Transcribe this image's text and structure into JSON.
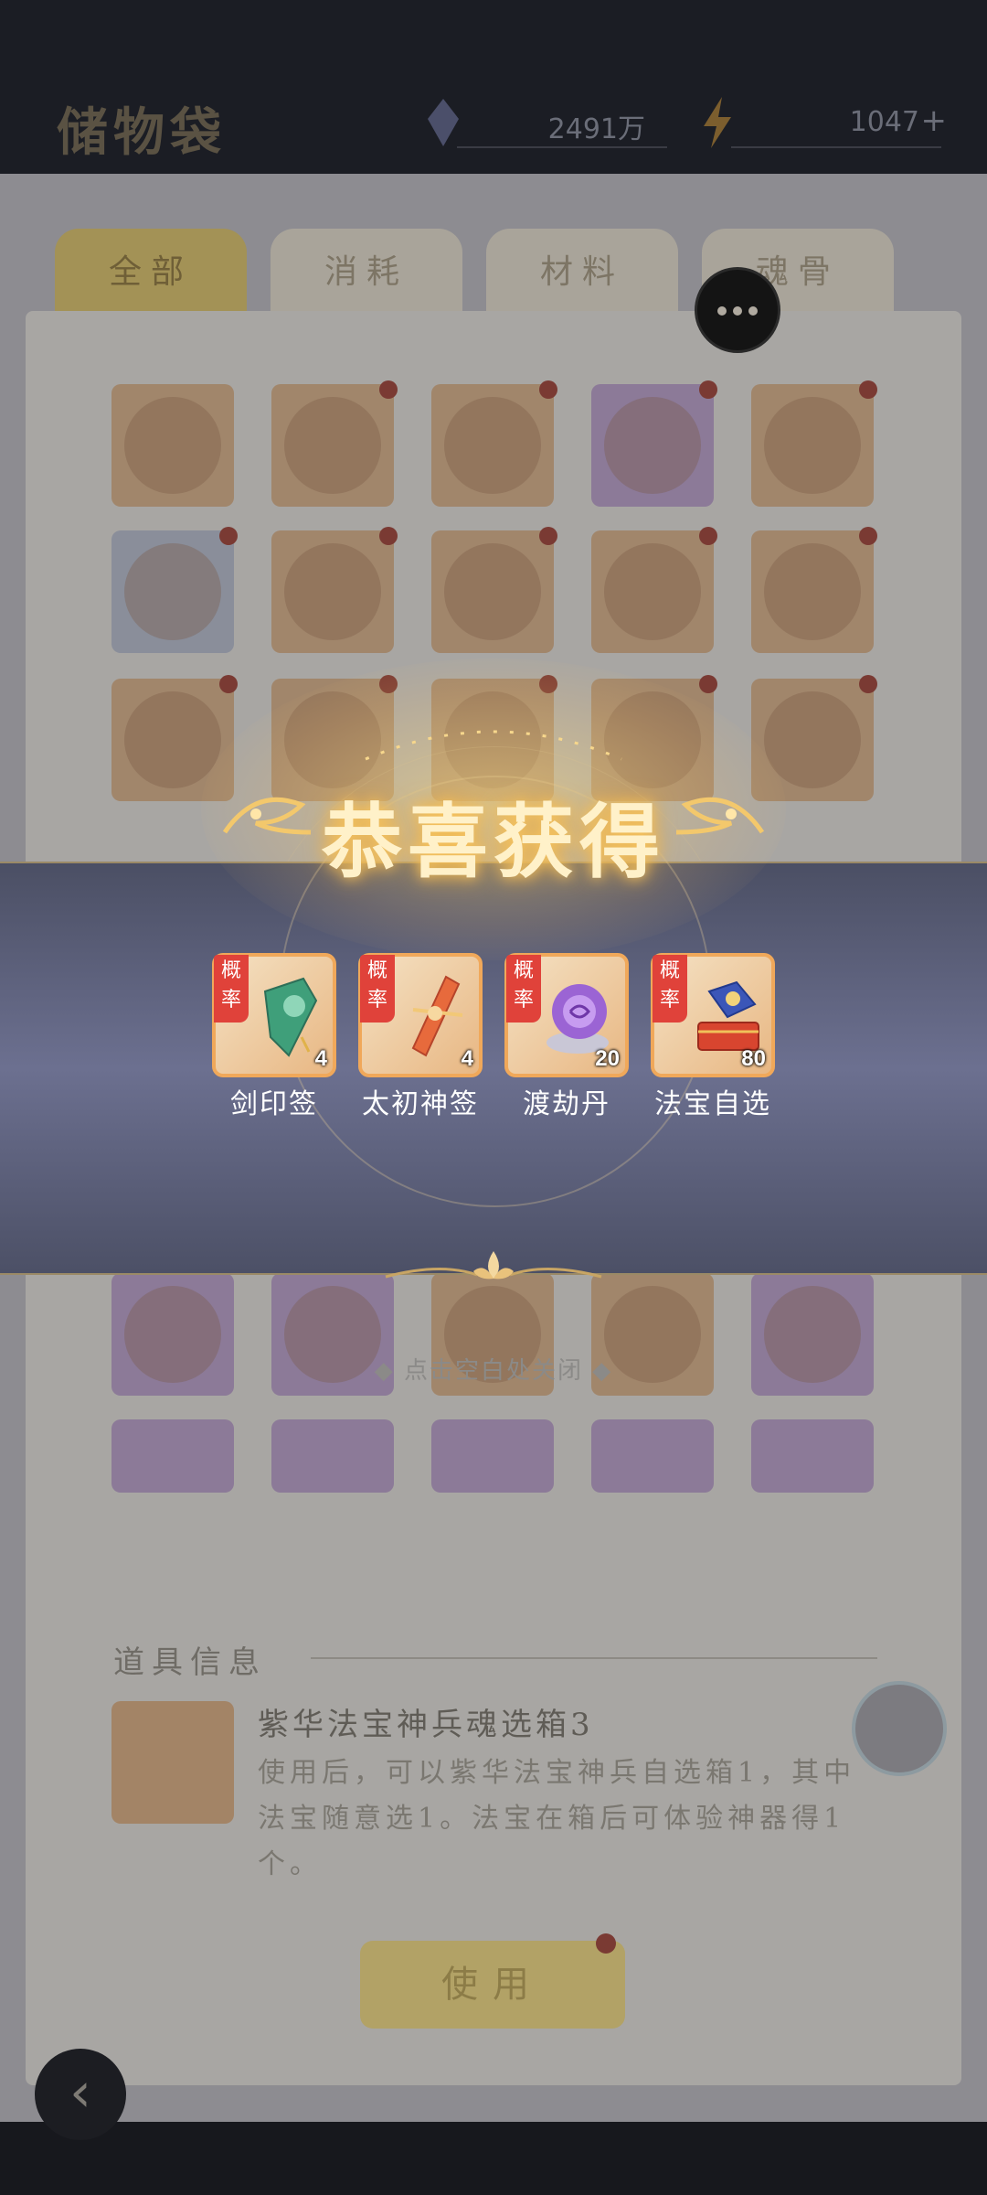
{
  "header": {
    "title": "储物袋",
    "resource_1": "2491万",
    "resource_2": "1047"
  },
  "tabs": [
    "全部",
    "消耗",
    "材料",
    "魂骨"
  ],
  "popup": {
    "title": "恭喜获得",
    "badge_text": "概率",
    "items": [
      {
        "name": "剑印签",
        "count": "4",
        "icon": "sword-seal-icon"
      },
      {
        "name": "太初神签",
        "count": "4",
        "icon": "divine-lot-icon"
      },
      {
        "name": "渡劫丹",
        "count": "20",
        "icon": "tribulation-pill-icon"
      },
      {
        "name": "法宝自选",
        "count": "80",
        "icon": "treasure-chest-icon"
      }
    ],
    "close_hint": "点击空白处关闭"
  },
  "detail": {
    "section_title": "道具信息",
    "item_name": "紫华法宝神兵魂选箱3",
    "description": "使用后，可以紫华法宝神兵自选箱1，其中法宝随意选1。法宝在箱后可体验神器得1个。"
  },
  "use_button": "使用",
  "colors": {
    "accent_gold": "#f0a85a",
    "badge_red": "#e0423a",
    "band": "#6c7090"
  }
}
